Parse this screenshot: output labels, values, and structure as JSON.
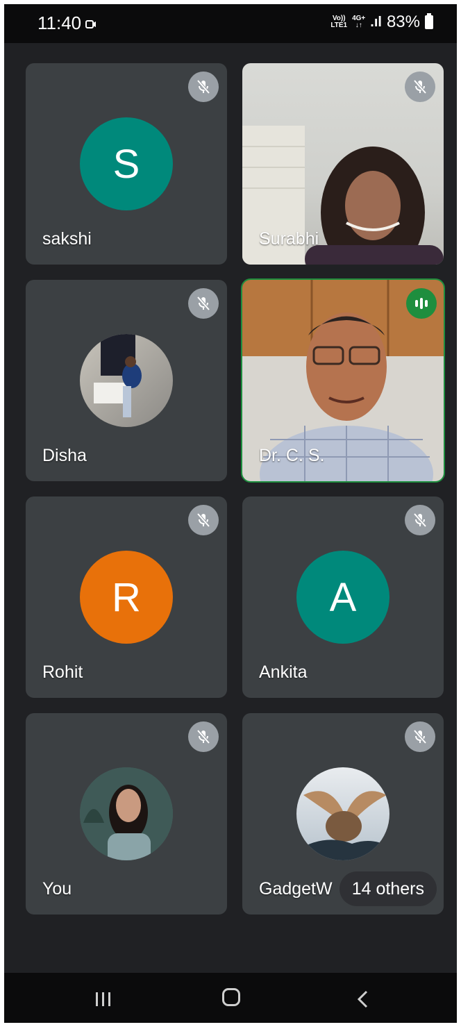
{
  "status_bar": {
    "time": "11:40",
    "volte_top": "Vo))",
    "volte_bottom": "LTE1",
    "net_top": "4G+",
    "net_bottom": "↓↑",
    "signal": ".ıl",
    "battery": "83%"
  },
  "participants": [
    {
      "name": "sakshi",
      "initial": "S",
      "avatar_color": "#00897b",
      "type": "letter",
      "mic": "muted"
    },
    {
      "name": "Surabhi",
      "type": "video",
      "mic": "muted"
    },
    {
      "name": "Disha",
      "type": "photo",
      "mic": "muted"
    },
    {
      "name": "Dr. C. S.",
      "type": "video",
      "mic": "speaking"
    },
    {
      "name": "Rohit",
      "initial": "R",
      "avatar_color": "#e8710a",
      "type": "letter",
      "mic": "muted"
    },
    {
      "name": "Ankita",
      "initial": "A",
      "avatar_color": "#00897b",
      "type": "letter",
      "mic": "muted"
    },
    {
      "name": "You",
      "type": "photo",
      "mic": "muted"
    },
    {
      "name": "GadgetW",
      "type": "photo",
      "mic": "muted"
    }
  ],
  "others_label": "14 others",
  "colors": {
    "background": "#202124",
    "tile": "#3c4043",
    "speaking": "#1e8e3e",
    "mic_badge": "#9aa0a6"
  },
  "nav": [
    "recents-icon",
    "home-icon",
    "back-icon"
  ]
}
